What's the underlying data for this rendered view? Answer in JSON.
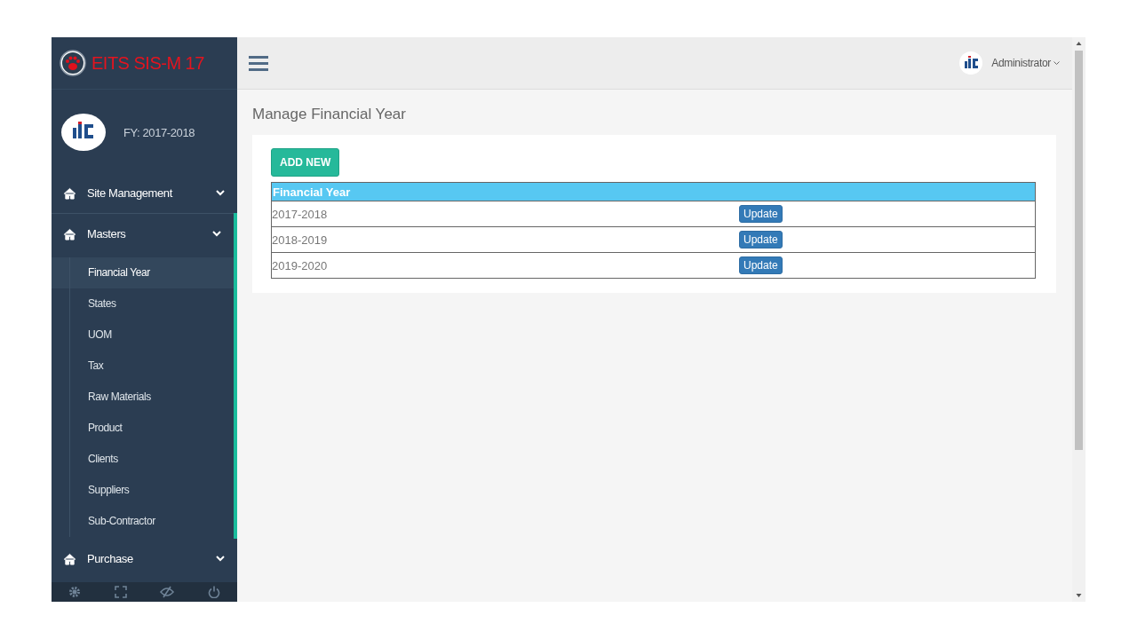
{
  "sidebar": {
    "brand": "EITS SIS-M 17",
    "fy": "FY: 2017-2018",
    "items": [
      {
        "label": "Site Management",
        "expanded": false
      },
      {
        "label": "Masters",
        "expanded": true,
        "children": [
          {
            "label": "Financial Year",
            "selected": true
          },
          {
            "label": "States",
            "selected": false
          },
          {
            "label": "UOM",
            "selected": false
          },
          {
            "label": "Tax",
            "selected": false
          },
          {
            "label": "Raw Materials",
            "selected": false
          },
          {
            "label": "Product",
            "selected": false
          },
          {
            "label": "Clients",
            "selected": false
          },
          {
            "label": "Suppliers",
            "selected": false
          },
          {
            "label": "Sub-Contractor",
            "selected": false
          }
        ]
      },
      {
        "label": "Purchase",
        "expanded": false
      }
    ]
  },
  "header": {
    "user": "Administrator"
  },
  "page": {
    "title": "Manage Financial Year",
    "add_button": "ADD NEW",
    "table": {
      "columns": [
        "Financial Year"
      ],
      "rows": [
        {
          "year": "2017-2018",
          "action": "Update"
        },
        {
          "year": "2018-2019",
          "action": "Update"
        },
        {
          "year": "2019-2020",
          "action": "Update"
        }
      ]
    }
  }
}
